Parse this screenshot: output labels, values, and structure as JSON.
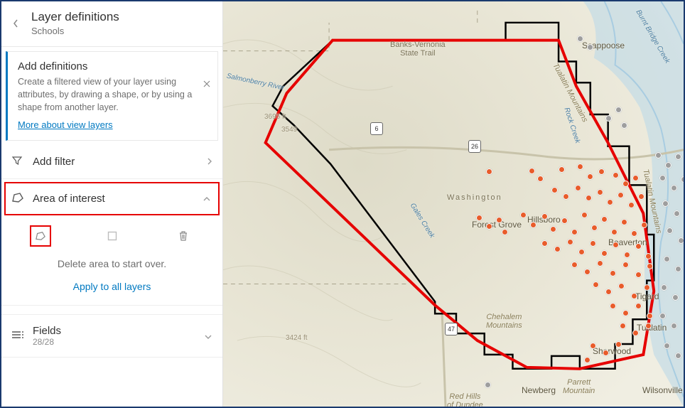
{
  "header": {
    "title": "Layer definitions",
    "subtitle": "Schools"
  },
  "info": {
    "title": "Add definitions",
    "desc": "Create a filtered view of your layer using attributes, by drawing a shape, or by using a shape from another layer.",
    "link": "More about view layers"
  },
  "filter": {
    "label": "Add filter"
  },
  "aoi": {
    "label": "Area of interest",
    "delete_msg": "Delete area to start over.",
    "apply": "Apply to all layers"
  },
  "fields": {
    "label": "Fields",
    "count": "28/28"
  },
  "map": {
    "labels": {
      "banks_vernonia": "Banks-Vernonia\nState Trail",
      "scappoose": "Scappoose",
      "tualatin_mtns": "Tualatin Mountains",
      "tualatin_mtns2": "Tualatin Mountains",
      "washington": "Washington",
      "forest_grove": "Forest Grove",
      "hillsboro": "Hillsboro",
      "beaverton": "Beaverton",
      "tigard": "Tigard",
      "tualatin": "Tualatin",
      "sherwood": "Sherwood",
      "newberg": "Newberg",
      "wilsonville": "Wilsonville",
      "parrett": "Parrett\nMountain",
      "chehalem": "Chehalem\nMountains",
      "red_hills": "Red Hills\nof Dundee",
      "gales_creek": "Gales Creek",
      "salmonberry": "Salmonberry River",
      "rock_creek": "Rock Creek",
      "burnt_bridge": "Burnt Bridge Creek",
      "elev_3695": "3695 ft",
      "elev_3549": "3549",
      "elev_3424": "3424 ft",
      "hwy6": "6",
      "hwy26": "26",
      "hwy47": "47"
    }
  }
}
